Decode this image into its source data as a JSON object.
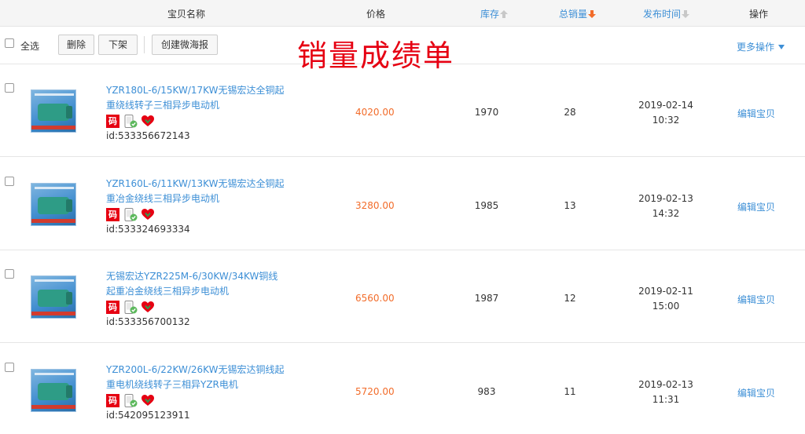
{
  "header": {
    "col_name": "宝贝名称",
    "col_price": "价格",
    "col_stock": "库存",
    "col_sales": "总销量",
    "col_published": "发布时间",
    "col_ops": "操作"
  },
  "toolbar": {
    "select_all": "全选",
    "delete": "删除",
    "delist": "下架",
    "create_poster": "创建微海报",
    "more_ops": "更多操作"
  },
  "overlay_title": "销量成绩单",
  "icons": {
    "code_badge": "码"
  },
  "colors": {
    "link_blue": "#3d8fd6",
    "price_orange": "#f26c2a",
    "sort_active": "#f26c2a",
    "sort_inactive": "#c8c8c8",
    "overlay_red": "#e60012"
  },
  "sort": {
    "stock": "inactive",
    "sales": "active",
    "published": "inactive"
  },
  "rows": [
    {
      "title": "YZR180L-6/15KW/17KW无锡宏达全铜起重绕线转子三相异步电动机",
      "id": "id:533356672143",
      "price": "4020.00",
      "stock": "1970",
      "sales": "28",
      "date": "2019-02-14",
      "time": "10:32",
      "edit": "编辑宝贝"
    },
    {
      "title": "YZR160L-6/11KW/13KW无锡宏达全铜起重冶金绕线三相异步电动机",
      "id": "id:533324693334",
      "price": "3280.00",
      "stock": "1985",
      "sales": "13",
      "date": "2019-02-13",
      "time": "14:32",
      "edit": "编辑宝贝"
    },
    {
      "title": "无锡宏达YZR225M-6/30KW/34KW铜线起重冶金绕线三相异步电动机",
      "id": "id:533356700132",
      "price": "6560.00",
      "stock": "1987",
      "sales": "12",
      "date": "2019-02-11",
      "time": "15:00",
      "edit": "编辑宝贝"
    },
    {
      "title": "YZR200L-6/22KW/26KW无锡宏达铜线起重电机绕线转子三相异YZR电机",
      "id": "id:542095123911",
      "price": "5720.00",
      "stock": "983",
      "sales": "11",
      "date": "2019-02-13",
      "time": "11:31",
      "edit": "编辑宝贝"
    }
  ]
}
